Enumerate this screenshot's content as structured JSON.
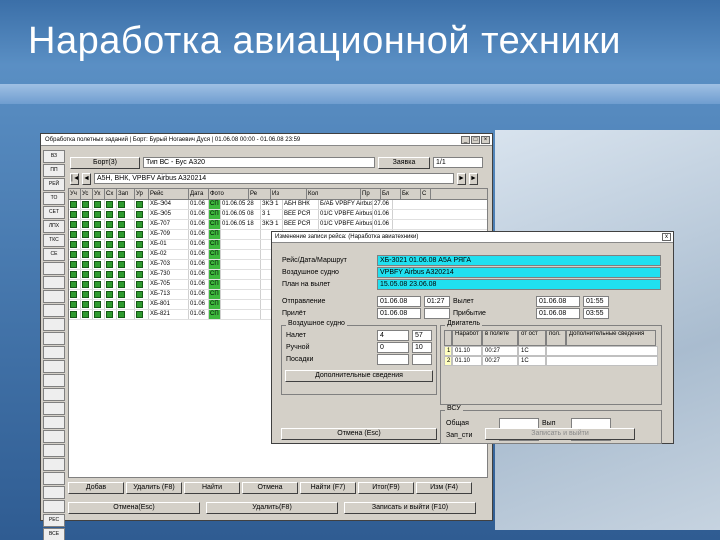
{
  "slide": {
    "title": "Наработка авиационной техники"
  },
  "main_window": {
    "title": "Обработка полетных заданий | Борт: Бурый Ногаевич Дуся | 01.06.08 00:00 - 01.06.08 23:59",
    "toolbar_items": [
      "ВЗ",
      "ПП",
      "РЕЙ",
      "ТО",
      "СЕТ",
      "ЛПХ",
      "ТКС",
      "СЕ",
      "",
      "",
      "",
      "",
      "",
      "",
      "",
      "",
      "",
      "",
      "",
      "",
      "",
      "",
      "",
      "",
      "",
      "",
      "РЕС",
      "ВСЕ"
    ],
    "bort_label": "Борт(3)",
    "type_value": "Тип ВС - Бус А320",
    "right_btn": "Заявка",
    "right_value": "1/1",
    "nav_value": "А5Н, ВНК, VPBFV Airbus A320214",
    "columns": [
      "Уч",
      "Ус",
      "Ух",
      "Сх",
      "Зап",
      "Ур",
      "Рейс",
      "Дата",
      "Отп",
      "Из",
      "Нет"
    ],
    "columns_right": [
      "Фото",
      "Ре",
      "Из",
      "Кол",
      "Пр",
      "Бл",
      "Бк",
      "С"
    ],
    "rows": [
      {
        "flight": "ХБ-Э04",
        "date": "01.06",
        "mid": "СП",
        "r1": "01.06.05 28",
        "r2": "ЗКЭ 1",
        "r3": "АБН ВНК",
        "r4": "Б/АБ VPBFY Airbus",
        "r5": "27.06"
      },
      {
        "flight": "ХБ-Э05",
        "date": "01.06",
        "mid": "СП",
        "r1": "01.06.05 08",
        "r2": "3 1",
        "r3": "ВЕЕ РСЯ",
        "r4": "01/С VPBFE Airbus",
        "r5": "01.06"
      },
      {
        "flight": "ХБ-707",
        "date": "01.06",
        "mid": "СП",
        "r1": "01.06.05 18",
        "r2": "ЗКЭ 1",
        "r3": "ВЕЕ РСЯ",
        "r4": "01/С VPBFE Airbus",
        "r5": "01.06"
      },
      {
        "flight": "ХБ-709",
        "date": "01.06",
        "mid": "СП",
        "r1": "",
        "r2": "",
        "r3": "",
        "r4": "",
        "r5": ""
      },
      {
        "flight": "ХБ-01",
        "date": "01.06",
        "mid": "СП",
        "r1": "",
        "r2": "",
        "r3": "",
        "r4": "",
        "r5": ""
      },
      {
        "flight": "ХБ-02",
        "date": "01.06",
        "mid": "СП",
        "r1": "",
        "r2": "",
        "r3": "",
        "r4": "",
        "r5": ""
      },
      {
        "flight": "ХБ-703",
        "date": "01.06",
        "mid": "СП",
        "r1": "",
        "r2": "",
        "r3": "",
        "r4": "",
        "r5": ""
      },
      {
        "flight": "ХБ-730",
        "date": "01.06",
        "mid": "СП",
        "r1": "",
        "r2": "",
        "r3": "",
        "r4": "",
        "r5": ""
      },
      {
        "flight": "ХБ-705",
        "date": "01.06",
        "mid": "СП",
        "r1": "",
        "r2": "",
        "r3": "",
        "r4": "",
        "r5": ""
      },
      {
        "flight": "ХБ-713",
        "date": "01.06",
        "mid": "СП",
        "r1": "",
        "r2": "",
        "r3": "",
        "r4": "",
        "r5": ""
      },
      {
        "flight": "ХБ-801",
        "date": "01.06",
        "mid": "СП",
        "r1": "",
        "r2": "",
        "r3": "",
        "r4": "",
        "r5": ""
      },
      {
        "flight": "ХБ-821",
        "date": "01.06",
        "mid": "СП",
        "r1": "",
        "r2": "",
        "r3": "",
        "r4": "",
        "r5": ""
      }
    ],
    "bottom_buttons": [
      "Добав",
      "Удалить (F8)",
      "Найти",
      "Отмена",
      "Найти (F7)",
      "Итог(F9)",
      "Изм (F4)"
    ],
    "bottom_buttons2": [
      "Отмена(Esc)",
      "Удалить(F8)",
      "Записать и выйти (F10)"
    ]
  },
  "dialog": {
    "title": "Изменение записи рейса: (Наработка авиатехники)",
    "close": "x",
    "rows": [
      {
        "label": "Рейс/Дата/Маршрут",
        "value": "ХБ-3021 01.06.08 А5А РЯГА"
      },
      {
        "label": "Воздушное судно",
        "value": "VPBFY Airbus A320214"
      },
      {
        "label": "План на вылет",
        "value": "15.05.08 23.06.08"
      }
    ],
    "times": [
      {
        "label": "Отправление",
        "v1": "01.06.08",
        "v2": "01:27",
        "label2": "Вылет",
        "v3": "01.06.08",
        "v4": "01:55"
      },
      {
        "label": "Прилёт",
        "v1": "01.06.08",
        "v2": "",
        "label2": "Прибытие",
        "v3": "01.06.08",
        "v4": "03:55"
      }
    ],
    "aircraft_group": "Воздушное судно",
    "aircraft_rows": [
      {
        "label": "Налет",
        "a": "4",
        "b": "57"
      },
      {
        "label": "Ручной",
        "a": "0",
        "b": "10"
      },
      {
        "label": "Посадки",
        "a": "",
        "b": ""
      }
    ],
    "extra_btn": "Дополнительные сведения",
    "engines_group": "Двигатель",
    "engine_heads": [
      "",
      "Наработ",
      "в полете",
      "от ост",
      "пол.",
      "Дополнительные сведения"
    ],
    "engine_rows": [
      {
        "n": "1",
        "a": "01.10",
        "b": "00:27",
        "c": "1С",
        "d": ""
      },
      {
        "n": "2",
        "a": "01.10",
        "b": "00:27",
        "c": "1С",
        "d": ""
      }
    ],
    "bottom_group": "ВСУ",
    "bottom_rows": [
      {
        "label": "Общая",
        "value": "",
        "label2": "Вып",
        "value2": ""
      },
      {
        "label": "Зап_сти",
        "value": "",
        "label2": "Выкл",
        "value2": ""
      }
    ],
    "ok_btn": "Отмена (Esc)",
    "save_btn": "Записать и выйти"
  }
}
